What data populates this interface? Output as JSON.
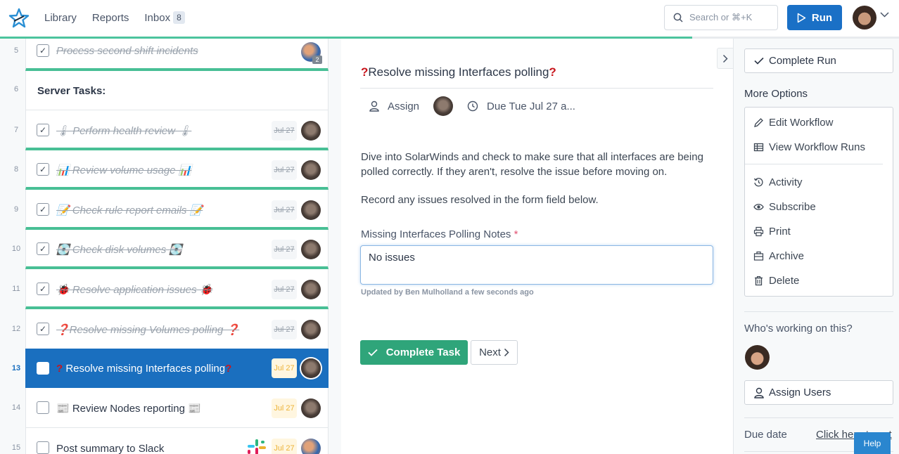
{
  "header": {
    "nav": [
      {
        "label": "Library"
      },
      {
        "label": "Reports"
      },
      {
        "label": "Inbox",
        "badge": "8"
      }
    ],
    "search_placeholder": "Search or ⌘+K",
    "run_label": "Run",
    "progress_percent": 77
  },
  "task_list": [
    {
      "num": "5",
      "title": "Process second shift incidents",
      "status": "done",
      "assignee_badge": "2"
    },
    {
      "num": "6",
      "section": "Server Tasks:"
    },
    {
      "num": "7",
      "title": "🌡 Perform health review 🌡",
      "status": "done",
      "date": "Jul 27"
    },
    {
      "num": "8",
      "title": "📊 Review volume usage 📊",
      "status": "done",
      "date": "Jul 27"
    },
    {
      "num": "9",
      "title": "📝 Check rule report emails 📝",
      "status": "done",
      "date": "Jul 27"
    },
    {
      "num": "10",
      "title": "💽 Check disk volumes 💽",
      "status": "done",
      "date": "Jul 27"
    },
    {
      "num": "11",
      "title": "🐞 Resolve application issues 🐞",
      "status": "done",
      "date": "Jul 27"
    },
    {
      "num": "12",
      "title": "❓Resolve missing Volumes polling ❓",
      "status": "done",
      "date": "Jul 27"
    },
    {
      "num": "13",
      "title": "Resolve missing Interfaces polling",
      "status": "active",
      "date": "Jul 27",
      "prefix": "?",
      "suffix": "?"
    },
    {
      "num": "14",
      "title": "📰 Review Nodes reporting 📰",
      "status": "open",
      "date": "Jul 27"
    },
    {
      "num": "15",
      "title": "Post summary to Slack",
      "status": "open",
      "date": "Jul 27"
    }
  ],
  "task": {
    "title_prefix": "?",
    "title": "Resolve missing Interfaces polling",
    "title_suffix": "?",
    "assign_label": "Assign",
    "due_label": "Due Tue Jul 27 a...",
    "description": [
      "Dive into SolarWinds and check to make sure that all interfaces are being polled correctly. If they aren't, resolve the issue before moving on.",
      "Record any issues resolved in the form field below."
    ],
    "field_label": "Missing Interfaces Polling Notes",
    "field_required": "*",
    "field_value": "No issues",
    "field_note": "Updated by Ben Mulholland a few seconds ago",
    "complete_label": "Complete Task",
    "next_label": "Next"
  },
  "sidebar": {
    "complete_run_label": "Complete Run",
    "more_options_label": "More Options",
    "menu": [
      {
        "label": "Edit Workflow",
        "icon": "pencil-icon"
      },
      {
        "label": "View Workflow Runs",
        "icon": "table-icon"
      },
      {
        "label": "Activity",
        "icon": "history-icon"
      },
      {
        "label": "Subscribe",
        "icon": "eye-icon"
      },
      {
        "label": "Print",
        "icon": "printer-icon"
      },
      {
        "label": "Archive",
        "icon": "archive-icon"
      },
      {
        "label": "Delete",
        "icon": "trash-icon"
      }
    ],
    "working_label": "Who's working on this?",
    "assign_users_label": "Assign Users",
    "due_date_label": "Due date",
    "due_date_link": "Click here to set"
  },
  "help_label": "Help",
  "colors": {
    "primary": "#1a70c6",
    "success": "#2fa57a",
    "progress": "#4cc49d",
    "date_badge": "#ecb43a"
  }
}
